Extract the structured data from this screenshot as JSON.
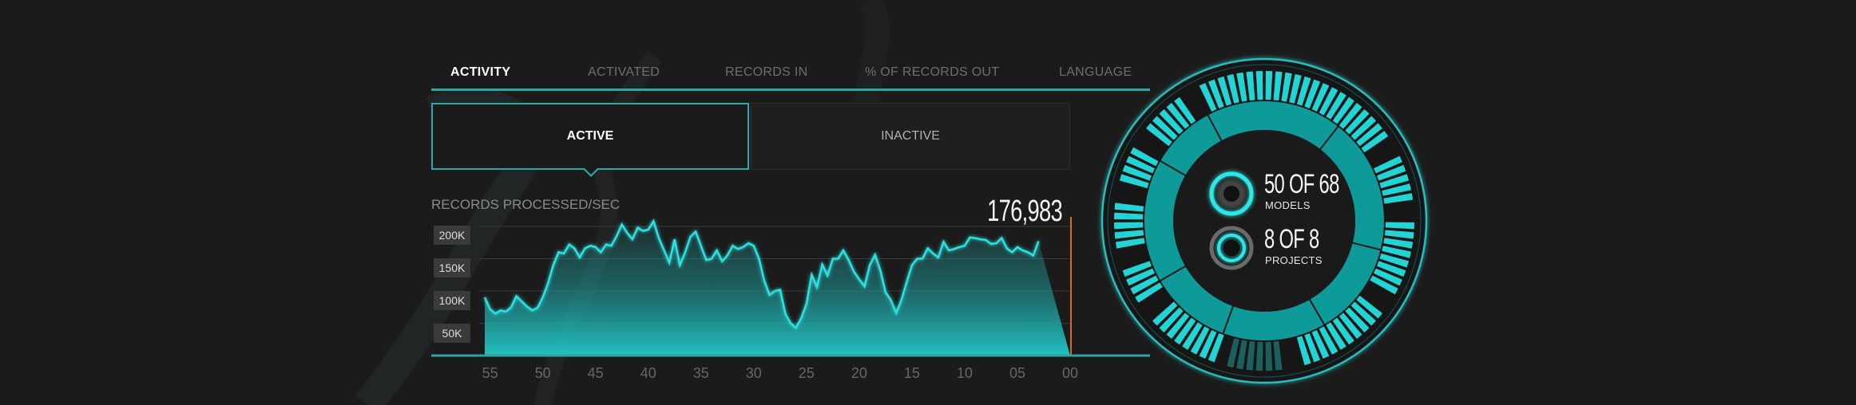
{
  "tabs": [
    {
      "label": "ACTIVITY",
      "active": true
    },
    {
      "label": "ACTIVATED",
      "active": false
    },
    {
      "label": "RECORDS IN",
      "active": false
    },
    {
      "label": "% OF RECORDS OUT",
      "active": false
    },
    {
      "label": "LANGUAGE",
      "active": false
    }
  ],
  "toggle": {
    "active_label": "ACTIVE",
    "inactive_label": "INACTIVE"
  },
  "chart_data": {
    "type": "area",
    "title": "RECORDS PROCESSED/SEC",
    "current_value": "176,983",
    "x_tick_labels": [
      "55",
      "50",
      "45",
      "40",
      "35",
      "30",
      "25",
      "20",
      "15",
      "10",
      "05",
      "00"
    ],
    "y_tick_labels": [
      "200K",
      "150K",
      "100K",
      "50K"
    ],
    "ylim": [
      0,
      225000
    ],
    "xlim": [
      55.5,
      0
    ],
    "grid": true,
    "color": "#2ad6d6",
    "x": [
      55.5,
      55,
      54.5,
      54,
      53.5,
      53,
      52.5,
      52,
      51.5,
      51,
      50.5,
      50,
      49.5,
      49,
      48.5,
      48,
      47.5,
      47,
      46.5,
      46,
      45.5,
      45,
      44.5,
      44,
      43.5,
      43,
      42.5,
      42,
      41.5,
      41,
      40.5,
      40,
      39.5,
      39,
      38.5,
      38,
      37.5,
      37,
      36.5,
      36,
      35.5,
      35,
      34.5,
      34,
      33.5,
      33,
      32.5,
      32,
      31.5,
      31,
      30.5,
      30,
      29.5,
      29,
      28.5,
      28,
      27.5,
      27,
      26.5,
      26,
      25.5,
      25,
      24.5,
      24,
      23.5,
      23,
      22.5,
      22,
      21.5,
      21,
      20.5,
      20,
      19.5,
      19,
      18.5,
      18,
      17.5,
      17,
      16.5,
      16,
      15.5,
      15,
      14.5,
      14,
      13.5,
      13,
      12.5,
      12,
      11.5,
      11,
      10.5,
      10,
      9.5,
      9,
      8.5,
      8,
      7.5,
      7,
      6.5,
      6,
      5.5,
      5,
      4.5,
      4,
      3.5,
      3,
      2.5,
      2,
      1.5,
      1,
      0.5,
      0
    ],
    "values": [
      90000,
      72000,
      65000,
      70000,
      68000,
      75000,
      92000,
      84000,
      76000,
      70000,
      74000,
      90000,
      112000,
      140000,
      160000,
      158000,
      172000,
      166000,
      152000,
      166000,
      170000,
      168000,
      160000,
      172000,
      170000,
      185000,
      203000,
      190000,
      180000,
      198000,
      193000,
      195000,
      208000,
      182000,
      163000,
      144000,
      180000,
      140000,
      160000,
      184000,
      192000,
      170000,
      148000,
      150000,
      163000,
      146000,
      155000,
      170000,
      165000,
      168000,
      174000,
      170000,
      150000,
      116000,
      94000,
      100000,
      102000,
      65000,
      50000,
      43000,
      58000,
      80000,
      125000,
      106000,
      141000,
      124000,
      150000,
      150000,
      163000,
      148000,
      130000,
      118000,
      107000,
      140000,
      156000,
      132000,
      98000,
      86000,
      66000,
      86000,
      114000,
      140000,
      150000,
      150000,
      166000,
      158000,
      152000,
      176000,
      163000,
      165000,
      168000,
      170000,
      183000,
      182000,
      180000,
      179000,
      173000,
      174000,
      182000,
      166000,
      160000,
      168000,
      163000,
      160000,
      155000,
      176983
    ]
  },
  "stats": {
    "models": {
      "big": "50 OF 68",
      "label": "MODELS"
    },
    "projects": {
      "big": "8 OF 8",
      "label": "PROJECTS"
    }
  },
  "colors": {
    "background": "#1b1b1b",
    "accent": "#2ad6d6",
    "ring_dark": "#0f9a9a",
    "muted": "#6e6e6e",
    "marker": "#d46a2a"
  },
  "icons": {
    "models": "ring-progress-icon",
    "projects": "ring-progress-icon"
  }
}
